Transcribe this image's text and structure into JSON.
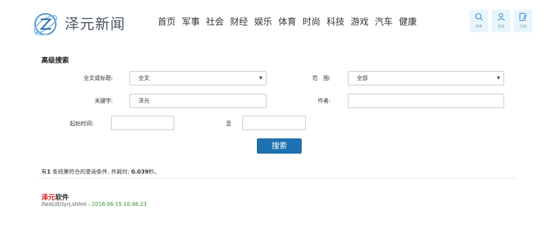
{
  "site": {
    "name": "泽元新闻"
  },
  "nav": [
    "首页",
    "军事",
    "社会",
    "财经",
    "娱乐",
    "体育",
    "时尚",
    "科技",
    "游戏",
    "汽车",
    "健康"
  ],
  "tools": [
    {
      "icon": "search-icon",
      "label": "搜索"
    },
    {
      "icon": "user-icon",
      "label": "登录"
    },
    {
      "icon": "register-icon",
      "label": "注册"
    }
  ],
  "form": {
    "title": "高级搜索",
    "field_label": "全文或标题:",
    "field_value": "全文",
    "scope_label": "范　围:",
    "scope_value": "全部",
    "keyword_label": "关键字:",
    "keyword_value": "泽元",
    "author_label": "作者:",
    "author_value": "",
    "start_label": "起始时间:",
    "start_value": "",
    "to_label": "至",
    "end_value": "",
    "search_button": "搜索"
  },
  "summary": {
    "prefix": "有",
    "count": "1",
    "middle": "条结果符合的查询条件,  共耗时:",
    "time": "0.039",
    "suffix": "秒。"
  },
  "results": [
    {
      "title_highlight": "泽元",
      "title_rest": "软件",
      "path": "/test/zt/zyrj.shtml",
      "sep": " - ",
      "date": "2018-06-15 10:46:23"
    }
  ],
  "colors": {
    "accent": "#1f72b2",
    "highlight": "#e02020",
    "date": "#2f8f2f"
  }
}
